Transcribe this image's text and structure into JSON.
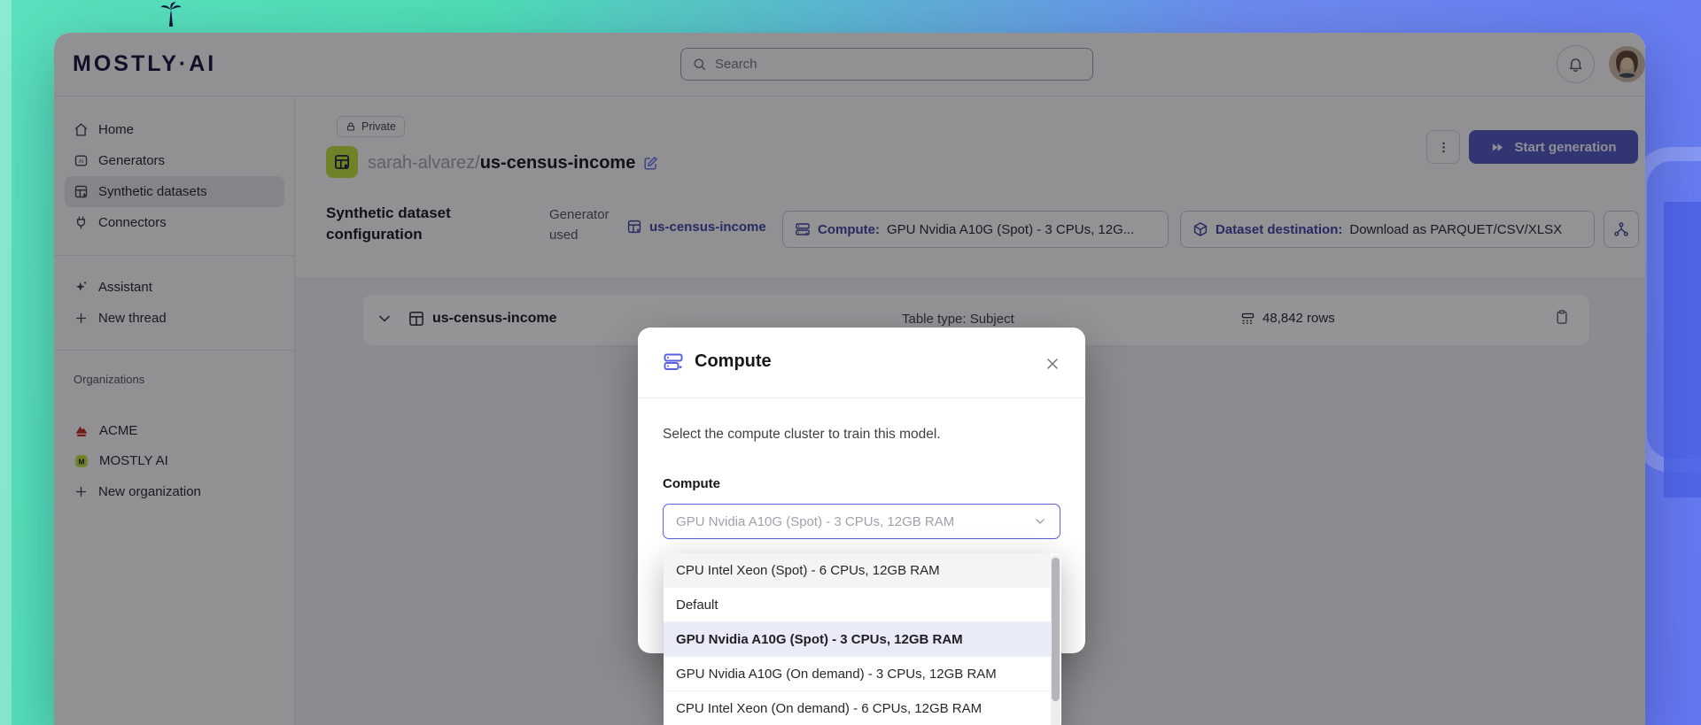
{
  "brand": {
    "logo_text": "MOSTLY·AI"
  },
  "header": {
    "search_placeholder": "Search"
  },
  "sidebar": {
    "items": [
      {
        "label": "Home"
      },
      {
        "label": "Generators"
      },
      {
        "label": "Synthetic datasets",
        "selected": true
      },
      {
        "label": "Connectors"
      }
    ],
    "assistant": [
      {
        "label": "Assistant"
      },
      {
        "label": "New thread"
      }
    ],
    "organizations_label": "Organizations",
    "organizations": [
      {
        "label": "ACME"
      },
      {
        "label": "MOSTLY AI"
      }
    ],
    "new_organization_label": "New organization"
  },
  "toolbar": {
    "privacy_badge": "Private",
    "breadcrumb_owner": "sarah-alvarez/",
    "breadcrumb_name": "us-census-income",
    "start_generation_label": "Start generation"
  },
  "config": {
    "section_title": "Synthetic dataset configuration",
    "generator_used_label": "Generator used",
    "generator_name": "us-census-income",
    "compute_label": "Compute:",
    "compute_value": "GPU Nvidia A10G (Spot) - 3 CPUs, 12G...",
    "destination_label": "Dataset destination:",
    "destination_value": "Download as PARQUET/CSV/XLSX"
  },
  "table": {
    "name": "us-census-income",
    "type": "Table type: Subject",
    "rows": "48,842 rows"
  },
  "modal": {
    "title": "Compute",
    "description": "Select the compute cluster to train this model.",
    "field_label": "Compute",
    "select_value": "GPU Nvidia A10G (Spot) - 3 CPUs, 12GB RAM",
    "options": [
      {
        "label": "CPU Intel Xeon (Spot) - 6 CPUs, 12GB RAM",
        "selected": false
      },
      {
        "label": "Default",
        "selected": false
      },
      {
        "label": "GPU Nvidia A10G (Spot) - 3 CPUs, 12GB RAM",
        "selected": true
      },
      {
        "label": "GPU Nvidia A10G (On demand) - 3 CPUs, 12GB RAM",
        "selected": false
      },
      {
        "label": "CPU Intel Xeon (On demand) - 6 CPUs, 12GB RAM",
        "selected": false
      }
    ]
  },
  "icons": {
    "search-icon": "magnifier",
    "bell-icon": "bell",
    "home-icon": "house",
    "generators-icon": "ai-box",
    "synthetic-datasets-icon": "table-sparkle",
    "connectors-icon": "plug",
    "assistant-icon": "sparkles",
    "plus-icon": "plus",
    "lock-icon": "padlock",
    "edit-icon": "pencil",
    "kebab-icon": "vertical-dots",
    "fast-forward-icon": "double-triangle",
    "compute-icon": "server-gear",
    "destination-icon": "cube",
    "graph-icon": "sitemap",
    "chevron-down-icon": "chevron",
    "close-icon": "x",
    "clipboard-icon": "clipboard",
    "rows-icon": "table-rows",
    "palm-tree-icon": "palm"
  },
  "colors": {
    "brand_navy": "#14143a",
    "brand_lime": "#bddf39",
    "primary_button": "#4f56bd",
    "link_indigo": "#3f439e",
    "select_border": "#5a5fe0",
    "selected_option_bg": "#e9ebf9",
    "acme_red": "#c0281e",
    "overlay": "rgba(12,12,18,0.44)",
    "desktop_gradient_left": "#5be0bf",
    "desktop_gradient_right": "#6577f2"
  }
}
